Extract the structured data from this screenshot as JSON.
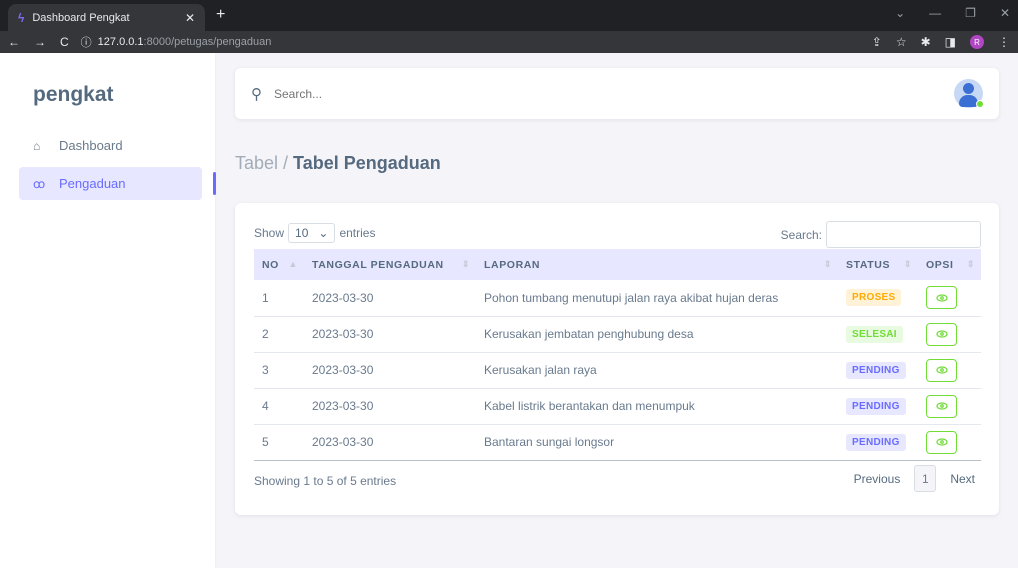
{
  "browser": {
    "tab_title": "Dashboard Pengkat",
    "url_host": "127.0.0.1",
    "url_path": ":8000/petugas/pengaduan",
    "profile_initial": "R"
  },
  "sidebar": {
    "brand": "pengkat",
    "items": [
      {
        "label": "Dashboard",
        "icon": "home-icon",
        "active": false
      },
      {
        "label": "Pengaduan",
        "icon": "users-icon",
        "active": true
      }
    ]
  },
  "search": {
    "placeholder": "Search..."
  },
  "breadcrumb": {
    "parent": "Tabel / ",
    "current": "Tabel Pengaduan"
  },
  "table": {
    "show_label": "Show",
    "page_length": "10",
    "entries_label": "entries",
    "search_label": "Search:",
    "columns": [
      "NO",
      "TANGGAL PENGADUAN",
      "LAPORAN",
      "STATUS",
      "OPSI"
    ],
    "rows": [
      {
        "no": "1",
        "tanggal": "2023-03-30",
        "laporan": "Pohon tumbang menutupi jalan raya akibat hujan deras",
        "status": "PROSES"
      },
      {
        "no": "2",
        "tanggal": "2023-03-30",
        "laporan": "Kerusakan jembatan penghubung desa",
        "status": "SELESAI"
      },
      {
        "no": "3",
        "tanggal": "2023-03-30",
        "laporan": "Kerusakan jalan raya",
        "status": "PENDING"
      },
      {
        "no": "4",
        "tanggal": "2023-03-30",
        "laporan": "Kabel listrik berantakan dan menumpuk",
        "status": "PENDING"
      },
      {
        "no": "5",
        "tanggal": "2023-03-30",
        "laporan": "Bantaran sungai longsor",
        "status": "PENDING"
      }
    ],
    "info": "Showing 1 to 5 of 5 entries",
    "pagination": {
      "previous": "Previous",
      "current": "1",
      "next": "Next"
    }
  },
  "colors": {
    "accent": "#696cff",
    "success": "#71dd37",
    "warning": "#ffab00"
  }
}
